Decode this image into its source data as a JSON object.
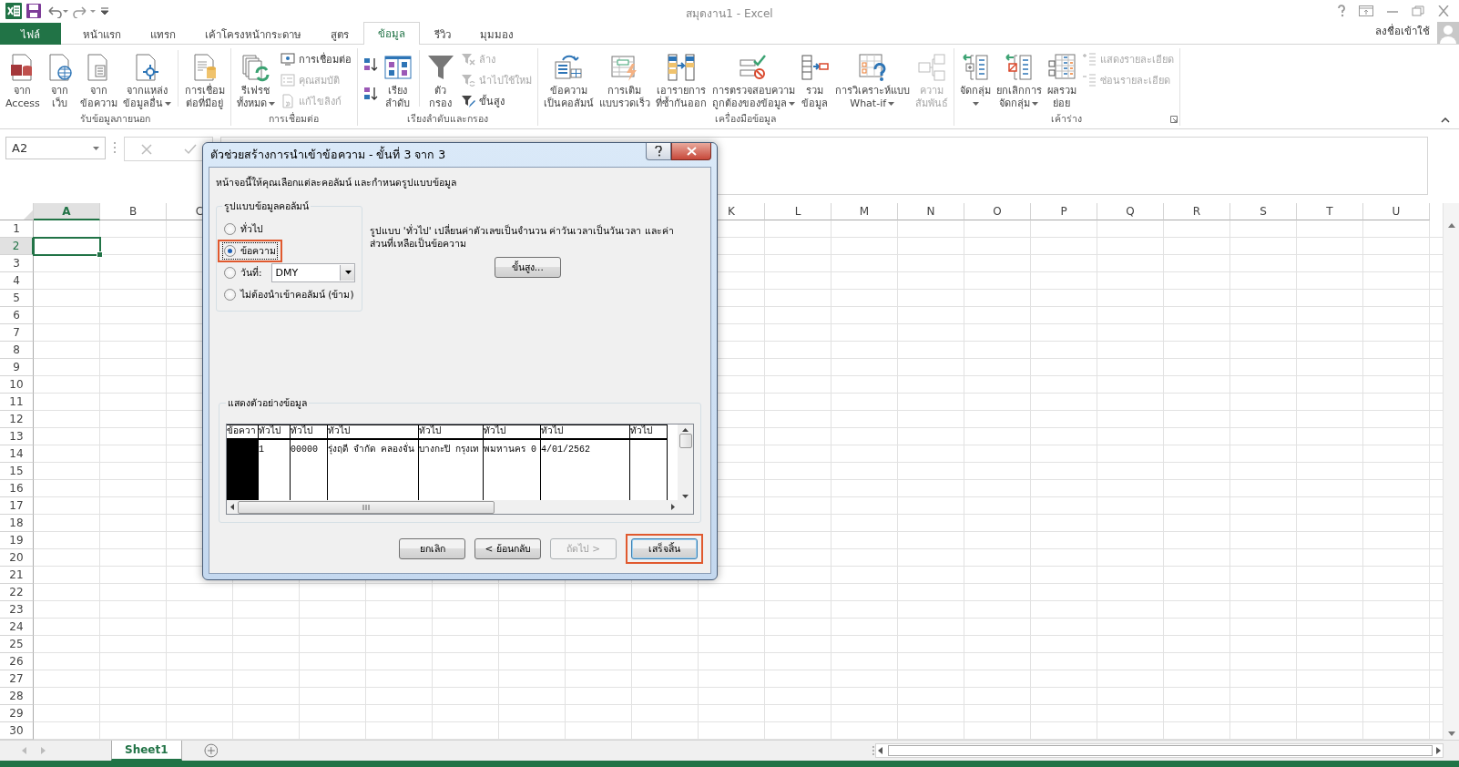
{
  "window": {
    "title": "สมุดงาน1 - Excel",
    "account": "ลงชื่อเข้าใช้"
  },
  "ribbon_tabs": [
    {
      "label": "ไฟล์",
      "kind": "file",
      "selected": false
    },
    {
      "label": "หน้าแรก",
      "kind": "tab",
      "selected": false
    },
    {
      "label": "แทรก",
      "kind": "tab",
      "selected": false
    },
    {
      "label": "เค้าโครงหน้ากระดาษ",
      "kind": "tab",
      "selected": false
    },
    {
      "label": "สูตร",
      "kind": "tab",
      "selected": false
    },
    {
      "label": "ข้อมูล",
      "kind": "tab",
      "selected": true
    },
    {
      "label": "รีวิว",
      "kind": "tab",
      "selected": false
    },
    {
      "label": "มุมมอง",
      "kind": "tab",
      "selected": false
    }
  ],
  "ribbon_groups": [
    {
      "label": "รับข้อมูลภายนอก",
      "launcher": false,
      "items": [
        {
          "kind": "large",
          "lines": [
            "จาก",
            "Access"
          ],
          "dropdown": false,
          "disabled": false
        },
        {
          "kind": "large",
          "lines": [
            "จาก",
            "เว็บ"
          ],
          "dropdown": false,
          "disabled": false
        },
        {
          "kind": "large",
          "lines": [
            "จาก",
            "ข้อความ"
          ],
          "dropdown": false,
          "disabled": false
        },
        {
          "kind": "large",
          "lines": [
            "จากแหล่ง",
            "ข้อมูลอื่น"
          ],
          "dropdown": true,
          "disabled": false
        },
        {
          "kind": "separator"
        },
        {
          "kind": "large",
          "lines": [
            "การเชื่อม",
            "ต่อที่มีอยู่"
          ],
          "dropdown": false,
          "disabled": false
        }
      ]
    },
    {
      "label": "การเชื่อมต่อ",
      "launcher": false,
      "items": [
        {
          "kind": "large",
          "lines": [
            "รีเฟรช",
            "ทั้งหมด"
          ],
          "dropdown": true,
          "disabled": false
        },
        {
          "kind": "stack",
          "entries": [
            {
              "label": "การเชื่อมต่อ",
              "disabled": false
            },
            {
              "label": "คุณสมบัติ",
              "disabled": true
            },
            {
              "label": "แก้ไขลิงก์",
              "disabled": true
            }
          ]
        }
      ]
    },
    {
      "label": "เรียงลำดับและกรอง",
      "launcher": false,
      "items": [
        {
          "kind": "sort-pair"
        },
        {
          "kind": "large",
          "lines": [
            "เรียง",
            "ลำดับ"
          ],
          "dropdown": false,
          "disabled": false
        },
        {
          "kind": "separator"
        },
        {
          "kind": "large",
          "lines": [
            "ตัว",
            "กรอง"
          ],
          "dropdown": false,
          "disabled": false
        },
        {
          "kind": "stack",
          "entries": [
            {
              "label": "ล้าง",
              "disabled": true
            },
            {
              "label": "นำไปใช้ใหม่",
              "disabled": true
            },
            {
              "label": "ขั้นสูง",
              "disabled": false
            }
          ]
        }
      ]
    },
    {
      "label": "เครื่องมือข้อมูล",
      "launcher": false,
      "items": [
        {
          "kind": "large",
          "lines": [
            "ข้อความ",
            "เป็นคอลัมน์"
          ],
          "dropdown": false,
          "disabled": false
        },
        {
          "kind": "large",
          "lines": [
            "การเติม",
            "แบบรวดเร็ว"
          ],
          "dropdown": false,
          "disabled": false
        },
        {
          "kind": "large",
          "lines": [
            "เอารายการ",
            "ที่ซ้ำกันออก"
          ],
          "dropdown": false,
          "disabled": false
        },
        {
          "kind": "large",
          "lines": [
            "การตรวจสอบความ",
            "ถูกต้องของข้อมูล"
          ],
          "dropdown": true,
          "disabled": false
        },
        {
          "kind": "large",
          "lines": [
            "รวม",
            "ข้อมูล"
          ],
          "dropdown": false,
          "disabled": false
        },
        {
          "kind": "large",
          "lines": [
            "การวิเคราะห์แบบ",
            "What-if"
          ],
          "dropdown": true,
          "disabled": false
        },
        {
          "kind": "large",
          "lines": [
            "ความ",
            "สัมพันธ์"
          ],
          "dropdown": false,
          "disabled": true
        }
      ]
    },
    {
      "label": "เค้าร่าง",
      "launcher": true,
      "items": [
        {
          "kind": "large",
          "lines": [
            "จัดกลุ่ม"
          ],
          "dropdown": true,
          "disabled": false
        },
        {
          "kind": "large",
          "lines": [
            "ยกเลิกการ",
            "จัดกลุ่ม"
          ],
          "dropdown": true,
          "disabled": false
        },
        {
          "kind": "large",
          "lines": [
            "ผลรวม",
            "ย่อย"
          ],
          "dropdown": false,
          "disabled": false
        },
        {
          "kind": "stack",
          "entries": [
            {
              "label": "แสดงรายละเอียด",
              "disabled": true
            },
            {
              "label": "ซ่อนรายละเอียด",
              "disabled": true
            }
          ]
        }
      ]
    }
  ],
  "formula_bar": {
    "name_box": "A2"
  },
  "sheet": {
    "columns": [
      {
        "label": "A",
        "selected": true
      },
      {
        "label": "B",
        "selected": false
      },
      {
        "label": "C",
        "selected": false
      },
      {
        "label": "K",
        "selected": false
      },
      {
        "label": "L",
        "selected": false
      },
      {
        "label": "M",
        "selected": false
      },
      {
        "label": "N",
        "selected": false
      },
      {
        "label": "O",
        "selected": false
      },
      {
        "label": "P",
        "selected": false
      },
      {
        "label": "Q",
        "selected": false
      },
      {
        "label": "R",
        "selected": false
      },
      {
        "label": "S",
        "selected": false
      },
      {
        "label": "T",
        "selected": false
      },
      {
        "label": "U",
        "selected": false
      }
    ],
    "rows": [
      {
        "label": "1",
        "selected": false
      },
      {
        "label": "2",
        "selected": true
      },
      {
        "label": "3",
        "selected": false
      },
      {
        "label": "4",
        "selected": false
      },
      {
        "label": "5",
        "selected": false
      },
      {
        "label": "6",
        "selected": false
      },
      {
        "label": "7",
        "selected": false
      },
      {
        "label": "8",
        "selected": false
      },
      {
        "label": "9",
        "selected": false
      },
      {
        "label": "10",
        "selected": false
      },
      {
        "label": "11",
        "selected": false
      },
      {
        "label": "12",
        "selected": false
      },
      {
        "label": "13",
        "selected": false
      },
      {
        "label": "14",
        "selected": false
      },
      {
        "label": "15",
        "selected": false
      },
      {
        "label": "16",
        "selected": false
      },
      {
        "label": "17",
        "selected": false
      },
      {
        "label": "18",
        "selected": false
      },
      {
        "label": "19",
        "selected": false
      },
      {
        "label": "20",
        "selected": false
      },
      {
        "label": "21",
        "selected": false
      },
      {
        "label": "22",
        "selected": false
      },
      {
        "label": "23",
        "selected": false
      },
      {
        "label": "24",
        "selected": false
      },
      {
        "label": "25",
        "selected": false
      },
      {
        "label": "26",
        "selected": false
      },
      {
        "label": "27",
        "selected": false
      },
      {
        "label": "28",
        "selected": false
      },
      {
        "label": "29",
        "selected": false
      },
      {
        "label": "30",
        "selected": false
      }
    ]
  },
  "sheet_tabs": [
    {
      "label": "Sheet1",
      "selected": true
    }
  ],
  "dialog": {
    "title": "ตัวช่วยสร้างการนำเข้าข้อความ - ขั้นที่ 3 จาก 3",
    "intro": "หน้าจอนี้ให้คุณเลือกแต่ละคอลัมน์ และกำหนดรูปแบบข้อมูล",
    "format_group": {
      "legend": "รูปแบบข้อมูลคอลัมน์",
      "options": [
        {
          "label": "ทั่วไป",
          "selected": false,
          "highlighted": false
        },
        {
          "label": "ข้อความ",
          "selected": true,
          "highlighted": true
        },
        {
          "label": "วันที่:",
          "selected": false,
          "highlighted": false,
          "date_format": "DMY"
        },
        {
          "label": "ไม่ต้องนำเข้าคอลัมน์ (ข้าม)",
          "selected": false,
          "highlighted": false
        }
      ]
    },
    "description": "รูปแบบ 'ทั่วไป' เปลี่ยนค่าตัวเลขเป็นจำนวน ค่าวันเวลาเป็นวันเวลา และค่าส่วนที่เหลือเป็นข้อความ",
    "advanced_button": "ขั้นสูง...",
    "preview": {
      "legend": "แสดงตัวอย่างข้อมูล",
      "columns": [
        {
          "type": "ข้อควา",
          "selected": true
        },
        {
          "type": "ทั่วไป",
          "value": "1",
          "selected": false
        },
        {
          "type": "ทั่วไป",
          "value": "00000",
          "selected": false
        },
        {
          "type": "ทั่วไป",
          "value": "รุ่งฤดี จำกัด คลองจั่น",
          "selected": false
        },
        {
          "type": "ทั่วไป",
          "value": "บางกะปิ กรุงเท",
          "selected": false
        },
        {
          "type": "ทั่วไป",
          "value": "พมหานคร 0",
          "selected": false
        },
        {
          "type": "ทั่วไป",
          "value": "4/01/2562",
          "selected": false
        },
        {
          "type": "ทั่วไป",
          "selected": false
        }
      ]
    },
    "buttons": [
      {
        "label": "ยกเลิก",
        "disabled": false,
        "default": false,
        "highlighted": false
      },
      {
        "label": "< ย้อนกลับ",
        "disabled": false,
        "default": false,
        "highlighted": false
      },
      {
        "label": "ถัดไป >",
        "disabled": true,
        "default": false,
        "highlighted": false
      },
      {
        "label": "เสร็จสิ้น",
        "disabled": false,
        "default": true,
        "highlighted": true
      }
    ]
  }
}
